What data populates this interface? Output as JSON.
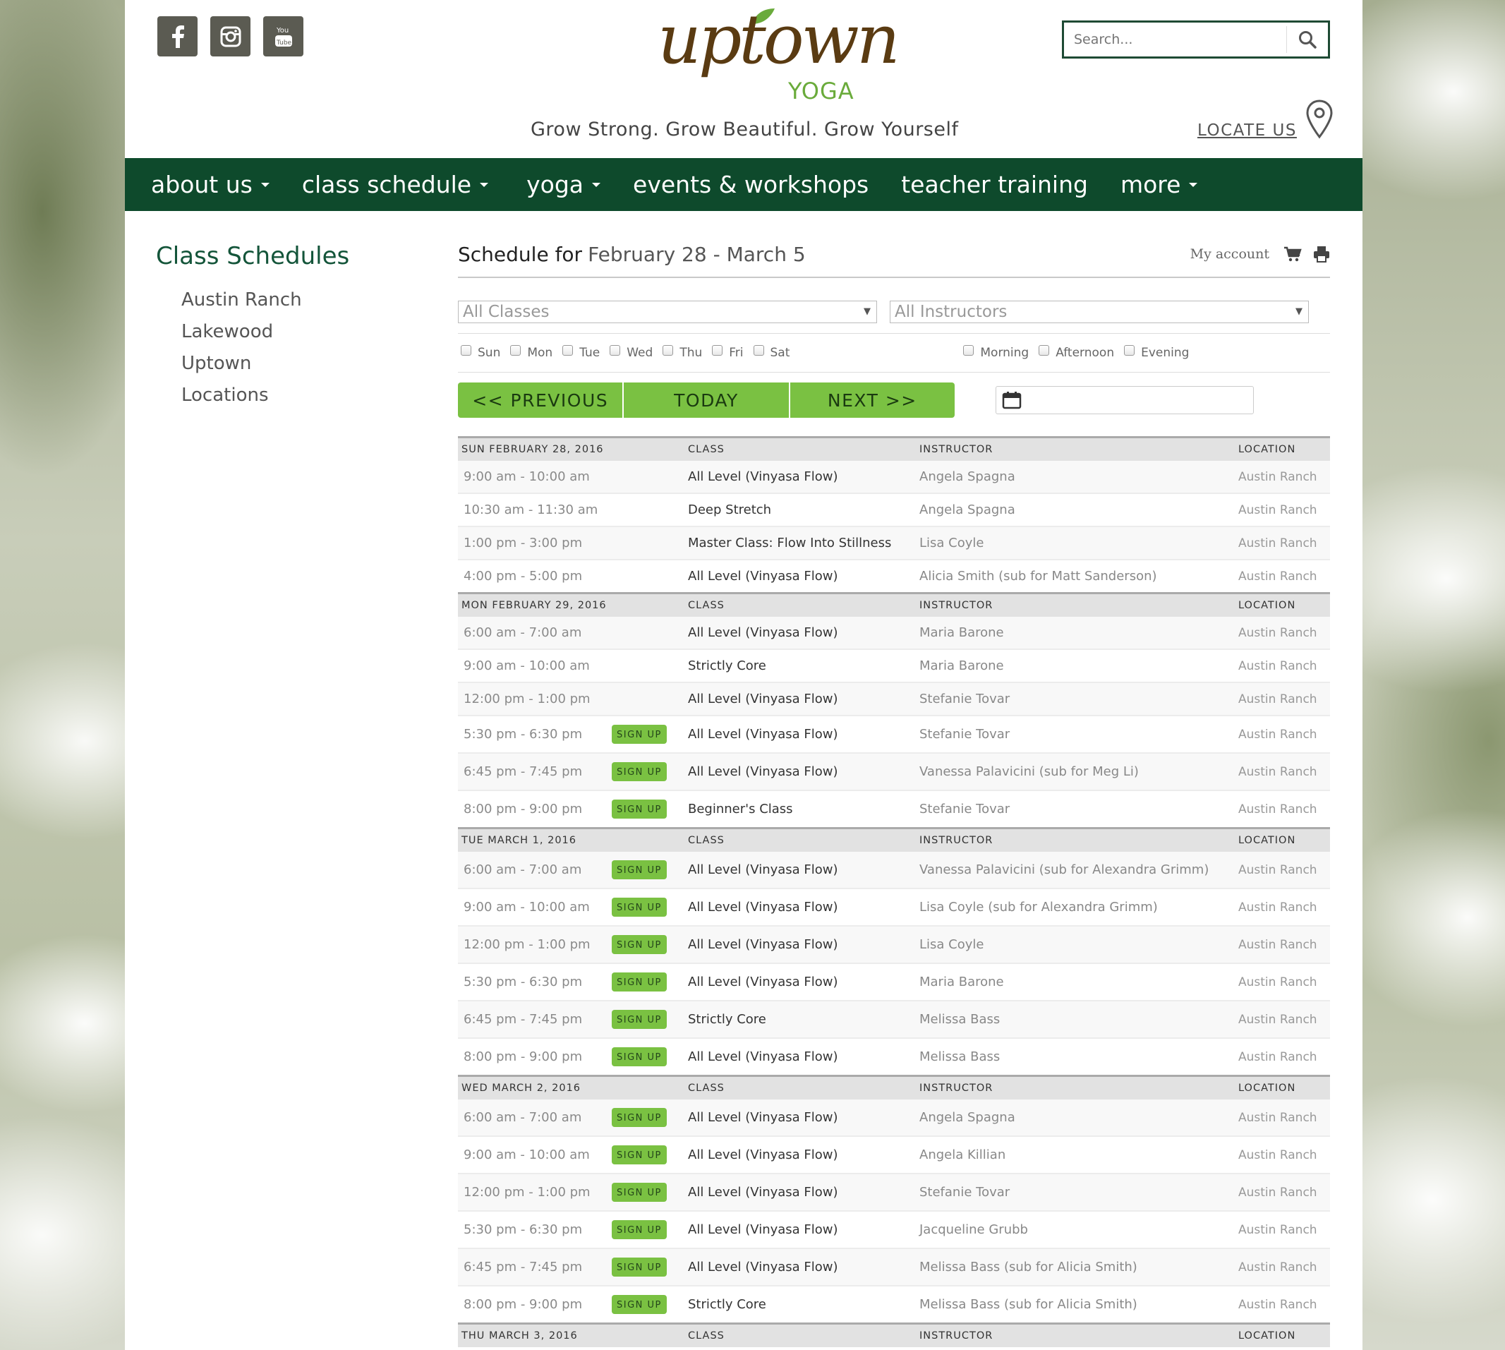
{
  "header": {
    "search_placeholder": "Search...",
    "logo_word": "uptown",
    "logo_yoga": "YOGA",
    "tagline": "Grow Strong.  Grow Beautiful.  Grow Yourself",
    "locate_label": "LOCATE US"
  },
  "nav": [
    "about us",
    "class schedule",
    "yoga",
    "events & workshops",
    "teacher training",
    "more"
  ],
  "sidebar": {
    "title": "Class Schedules",
    "items": [
      "Austin Ranch",
      "Lakewood",
      "Uptown",
      "Locations"
    ]
  },
  "schedule": {
    "label": "Schedule for",
    "range": "February 28 - March 5",
    "my_account": "My account",
    "classes_filter": "All Classes",
    "instructors_filter": "All Instructors",
    "days": [
      "Sun",
      "Mon",
      "Tue",
      "Wed",
      "Thu",
      "Fri",
      "Sat"
    ],
    "times": [
      "Morning",
      "Afternoon",
      "Evening"
    ],
    "prev": "<< PREVIOUS",
    "today": "TODAY",
    "next": "NEXT >>",
    "signup": "SIGN UP",
    "columns": {
      "class": "CLASS",
      "instructor": "INSTRUCTOR",
      "location": "LOCATION"
    },
    "groups": [
      {
        "date": "SUN FEBRUARY 28, 2016",
        "rows": [
          {
            "time": "9:00 am - 10:00 am",
            "signup": false,
            "class": "All Level (Vinyasa Flow)",
            "instructor": "Angela Spagna",
            "location": "Austin Ranch"
          },
          {
            "time": "10:30 am - 11:30 am",
            "signup": false,
            "class": "Deep Stretch",
            "instructor": "Angela Spagna",
            "location": "Austin Ranch"
          },
          {
            "time": "1:00 pm - 3:00 pm",
            "signup": false,
            "class": "Master Class: Flow Into Stillness",
            "instructor": "Lisa Coyle",
            "location": "Austin Ranch"
          },
          {
            "time": "4:00 pm - 5:00 pm",
            "signup": false,
            "class": "All Level (Vinyasa Flow)",
            "instructor": "Alicia Smith (sub for Matt Sanderson)",
            "location": "Austin Ranch"
          }
        ]
      },
      {
        "date": "MON FEBRUARY 29, 2016",
        "rows": [
          {
            "time": "6:00 am - 7:00 am",
            "signup": false,
            "class": "All Level (Vinyasa Flow)",
            "instructor": "Maria Barone",
            "location": "Austin Ranch"
          },
          {
            "time": "9:00 am - 10:00 am",
            "signup": false,
            "class": "Strictly Core",
            "instructor": "Maria Barone",
            "location": "Austin Ranch"
          },
          {
            "time": "12:00 pm - 1:00 pm",
            "signup": false,
            "class": "All Level (Vinyasa Flow)",
            "instructor": "Stefanie Tovar",
            "location": "Austin Ranch"
          },
          {
            "time": "5:30 pm - 6:30 pm",
            "signup": true,
            "class": "All Level (Vinyasa Flow)",
            "instructor": "Stefanie Tovar",
            "location": "Austin Ranch"
          },
          {
            "time": "6:45 pm - 7:45 pm",
            "signup": true,
            "class": "All Level (Vinyasa Flow)",
            "instructor": "Vanessa Palavicini (sub for Meg Li)",
            "location": "Austin Ranch"
          },
          {
            "time": "8:00 pm - 9:00 pm",
            "signup": true,
            "class": "Beginner's Class",
            "instructor": "Stefanie Tovar",
            "location": "Austin Ranch"
          }
        ]
      },
      {
        "date": "TUE MARCH 1, 2016",
        "rows": [
          {
            "time": "6:00 am - 7:00 am",
            "signup": true,
            "class": "All Level (Vinyasa Flow)",
            "instructor": "Vanessa Palavicini (sub for Alexandra Grimm)",
            "location": "Austin Ranch"
          },
          {
            "time": "9:00 am - 10:00 am",
            "signup": true,
            "class": "All Level (Vinyasa Flow)",
            "instructor": "Lisa Coyle (sub for Alexandra Grimm)",
            "location": "Austin Ranch"
          },
          {
            "time": "12:00 pm - 1:00 pm",
            "signup": true,
            "class": "All Level (Vinyasa Flow)",
            "instructor": "Lisa Coyle",
            "location": "Austin Ranch"
          },
          {
            "time": "5:30 pm - 6:30 pm",
            "signup": true,
            "class": "All Level (Vinyasa Flow)",
            "instructor": "Maria Barone",
            "location": "Austin Ranch"
          },
          {
            "time": "6:45 pm - 7:45 pm",
            "signup": true,
            "class": "Strictly Core",
            "instructor": "Melissa Bass",
            "location": "Austin Ranch"
          },
          {
            "time": "8:00 pm - 9:00 pm",
            "signup": true,
            "class": "All Level (Vinyasa Flow)",
            "instructor": "Melissa Bass",
            "location": "Austin Ranch"
          }
        ]
      },
      {
        "date": "WED MARCH 2, 2016",
        "rows": [
          {
            "time": "6:00 am - 7:00 am",
            "signup": true,
            "class": "All Level (Vinyasa Flow)",
            "instructor": "Angela Spagna",
            "location": "Austin Ranch"
          },
          {
            "time": "9:00 am - 10:00 am",
            "signup": true,
            "class": "All Level (Vinyasa Flow)",
            "instructor": "Angela Killian",
            "location": "Austin Ranch"
          },
          {
            "time": "12:00 pm - 1:00 pm",
            "signup": true,
            "class": "All Level (Vinyasa Flow)",
            "instructor": "Stefanie Tovar",
            "location": "Austin Ranch"
          },
          {
            "time": "5:30 pm - 6:30 pm",
            "signup": true,
            "class": "All Level (Vinyasa Flow)",
            "instructor": "Jacqueline Grubb",
            "location": "Austin Ranch"
          },
          {
            "time": "6:45 pm - 7:45 pm",
            "signup": true,
            "class": "All Level (Vinyasa Flow)",
            "instructor": "Melissa Bass (sub for Alicia Smith)",
            "location": "Austin Ranch"
          },
          {
            "time": "8:00 pm - 9:00 pm",
            "signup": true,
            "class": "Strictly Core",
            "instructor": "Melissa Bass (sub for Alicia Smith)",
            "location": "Austin Ranch"
          }
        ]
      },
      {
        "date": "THU MARCH 3, 2016",
        "rows": []
      }
    ]
  }
}
